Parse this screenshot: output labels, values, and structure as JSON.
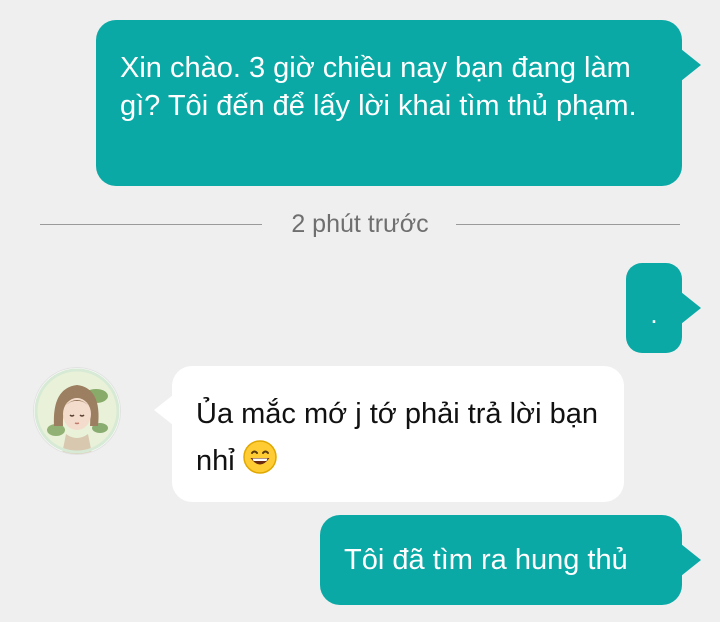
{
  "messages": [
    {
      "direction": "outgoing",
      "text": "Xin chào.  3 giờ chiều nay bạn đang làm gì?  Tôi đến để lấy lời khai tìm thủ phạm."
    },
    {
      "direction": "outgoing",
      "text": "."
    },
    {
      "direction": "incoming",
      "text": "Ủa mắc mớ j tớ phải trả lời bạn nhỉ",
      "emoji": "grinning-face-emoji"
    },
    {
      "direction": "outgoing",
      "text": "Tôi đã tìm ra hung thủ"
    }
  ],
  "divider": {
    "timestamp": "2 phút trước"
  },
  "colors": {
    "background": "#efefef",
    "outgoing_bubble": "#0aa9a6",
    "incoming_bubble": "#ffffff",
    "divider_text": "#6f6f6f"
  },
  "icons": {
    "avatar": "contact-avatar-anime-girl",
    "emoji": "grinning-face-emoji"
  }
}
